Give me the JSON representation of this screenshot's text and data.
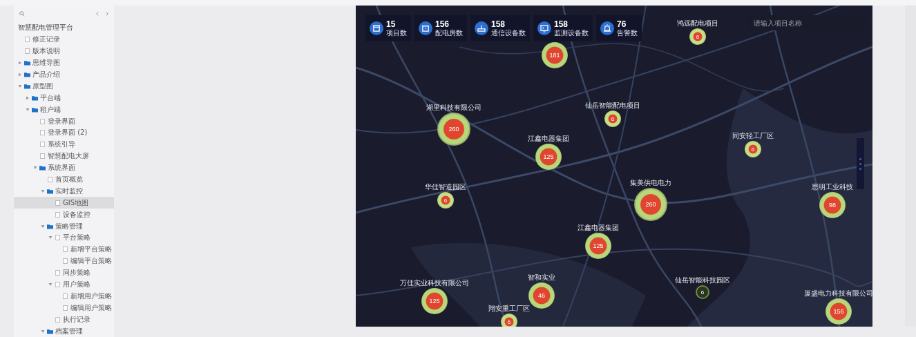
{
  "sidebar": {
    "title": "智慧配电管理平台",
    "tree": [
      {
        "label": "修正记录",
        "kind": "page",
        "selected": false
      },
      {
        "label": "版本说明",
        "kind": "page",
        "selected": false
      },
      {
        "label": "思维导图",
        "kind": "folder",
        "expanded": false,
        "selected": false
      },
      {
        "label": "产品介绍",
        "kind": "folder",
        "expanded": false,
        "selected": false
      },
      {
        "label": "原型图",
        "kind": "folder",
        "expanded": true,
        "selected": false,
        "children": [
          {
            "label": "平台端",
            "kind": "folder",
            "expanded": false,
            "selected": false
          },
          {
            "label": "租户端",
            "kind": "folder",
            "expanded": true,
            "selected": false,
            "children": [
              {
                "label": "登录界面",
                "kind": "page",
                "selected": false
              },
              {
                "label": "登录界面 (2)",
                "kind": "page",
                "selected": false
              },
              {
                "label": "系统引导",
                "kind": "page",
                "selected": false
              },
              {
                "label": "智慧配电大屏",
                "kind": "page",
                "selected": false
              },
              {
                "label": "系统界面",
                "kind": "folder",
                "expanded": true,
                "selected": false,
                "children": [
                  {
                    "label": "首页概览",
                    "kind": "page",
                    "selected": false
                  },
                  {
                    "label": "实时监控",
                    "kind": "folder",
                    "expanded": true,
                    "selected": false,
                    "children": [
                      {
                        "label": "GIS地图",
                        "kind": "page",
                        "selected": true
                      },
                      {
                        "label": "设备监控",
                        "kind": "page",
                        "selected": false
                      }
                    ]
                  },
                  {
                    "label": "策略管理",
                    "kind": "folder",
                    "expanded": true,
                    "selected": false,
                    "children": [
                      {
                        "label": "平台策略",
                        "kind": "page",
                        "expanded": true,
                        "selected": false,
                        "children": [
                          {
                            "label": "新增平台策略",
                            "kind": "page",
                            "selected": false
                          },
                          {
                            "label": "编辑平台策略",
                            "kind": "page",
                            "selected": false
                          }
                        ]
                      },
                      {
                        "label": "同步策略",
                        "kind": "page",
                        "selected": false
                      },
                      {
                        "label": "用户策略",
                        "kind": "page",
                        "expanded": true,
                        "selected": false,
                        "children": [
                          {
                            "label": "新增用户策略",
                            "kind": "page",
                            "selected": false
                          },
                          {
                            "label": "编辑用户策略",
                            "kind": "page",
                            "selected": false
                          }
                        ]
                      },
                      {
                        "label": "执行记录",
                        "kind": "page",
                        "selected": false
                      }
                    ]
                  },
                  {
                    "label": "档案管理",
                    "kind": "folder",
                    "expanded": true,
                    "selected": false
                  }
                ]
              }
            ]
          }
        ]
      }
    ]
  },
  "map": {
    "kind": "picture",
    "stats": [
      {
        "value": "15",
        "label": "项目数"
      },
      {
        "value": "156",
        "label": "配电房数"
      },
      {
        "value": "158",
        "label": "通信设备数"
      },
      {
        "value": "158",
        "label": "监测设备数"
      },
      {
        "value": "76",
        "label": "告警数"
      }
    ],
    "search": {
      "placeholder": "请输入项目名称"
    },
    "clusters": [
      {
        "label": "鸿远配电项目",
        "count": "6",
        "kind": "small"
      },
      {
        "count": "181",
        "kind": "medium"
      },
      {
        "label": "湖里科技有限公司",
        "count": "260",
        "kind": "large"
      },
      {
        "label": "仙岳智能配电项目",
        "count": "6",
        "kind": "small"
      },
      {
        "label": "江鑫电器集团",
        "count": "125",
        "kind": "medium"
      },
      {
        "label": "同安轻工厂区",
        "count": "6",
        "kind": "small"
      },
      {
        "label": "华佳智造园区",
        "count": "6",
        "kind": "small"
      },
      {
        "label": "集美供电电力",
        "count": "260",
        "kind": "large"
      },
      {
        "label": "思明工业科技",
        "count": "98",
        "kind": "medium"
      },
      {
        "label": "江鑫电器集团",
        "count": "125",
        "kind": "medium"
      },
      {
        "label": "万佳实业科技有限公司",
        "count": "125",
        "kind": "medium"
      },
      {
        "label": "智和实业",
        "count": "46",
        "kind": "medium"
      },
      {
        "label": "翔安重工厂区",
        "count": "6",
        "kind": "small"
      },
      {
        "label": "仙岳智能科技园区",
        "count": "6",
        "kind": "outline"
      },
      {
        "label": "厦盛电力科技有限公司",
        "count": "156",
        "kind": "medium"
      }
    ]
  }
}
